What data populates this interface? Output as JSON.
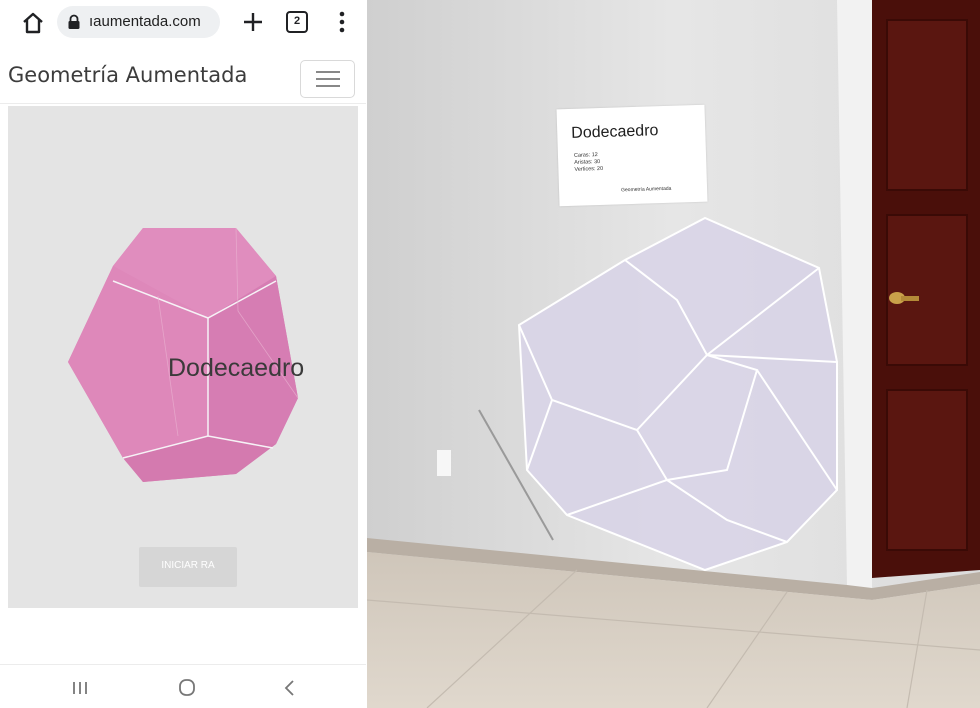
{
  "browser": {
    "url_display": "ıaumentada.com",
    "tab_count": "2",
    "icons": [
      "home-icon",
      "lock-icon",
      "plus-icon",
      "tabs-icon",
      "menu-dots-icon"
    ]
  },
  "app": {
    "title": "Geometría Aumentada",
    "menu_icon": "hamburger-icon"
  },
  "viewer": {
    "shape_label": "Dodecaedro",
    "start_button": "INICIAR RA",
    "shape_color": "#dc85b8",
    "edge_color": "#ffffff",
    "background": "#e4e4e4"
  },
  "nav": {
    "icons": [
      "recent-apps-icon",
      "home-circle-icon",
      "back-icon"
    ]
  },
  "ar_card": {
    "title": "Dodecaedro",
    "caras": "Caras: 12",
    "aristas": "Aristas: 30",
    "vertices": "Vertices: 20",
    "footer": "Geometría Aumentada"
  },
  "ar_view": {
    "shape_color": "#d9d5e6",
    "wall_color": "#e3e3e3",
    "door_color": "#4a0f0a",
    "floor_color": "#d7cfc4"
  }
}
